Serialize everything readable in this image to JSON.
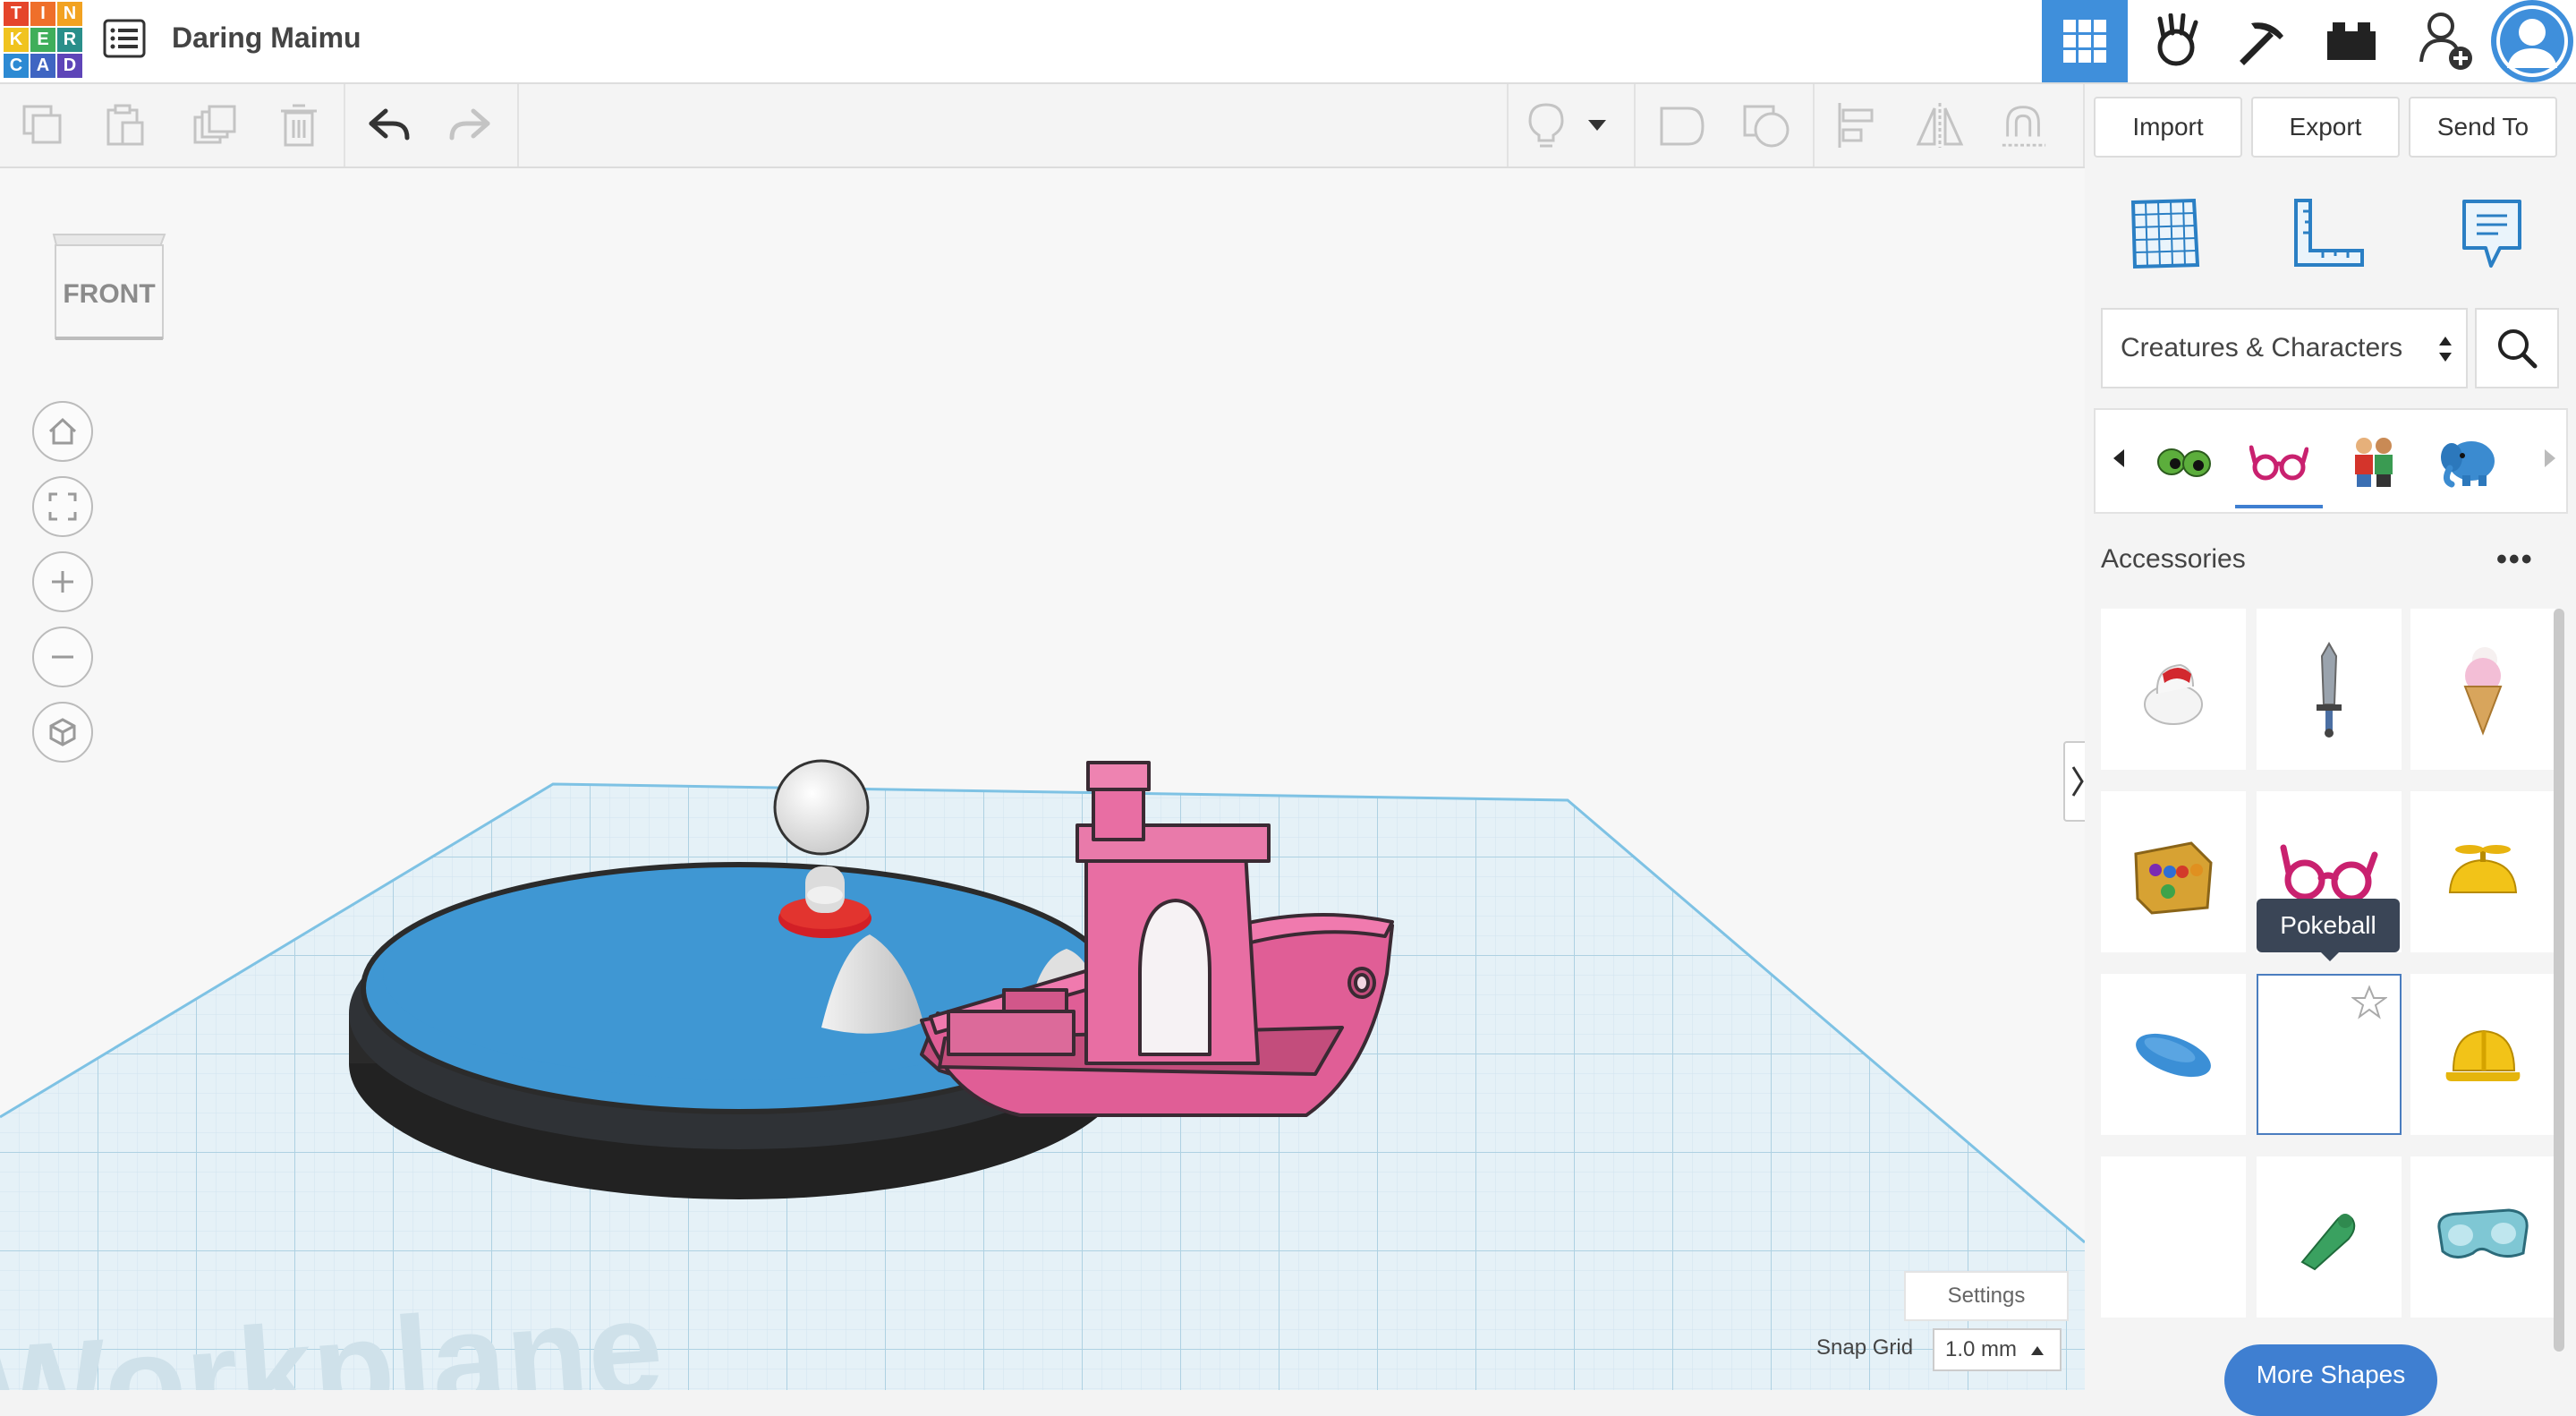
{
  "app": {
    "logo_letters": [
      "T",
      "I",
      "N",
      "K",
      "E",
      "R",
      "C",
      "A",
      "D"
    ],
    "logo_colors": [
      "#e5452b",
      "#ef6f2a",
      "#f2a221",
      "#f0c31f",
      "#3fae5a",
      "#2a8f8a",
      "#2d8ad3",
      "#3f65c2",
      "#5e45b8"
    ],
    "project_title": "Daring Maimu"
  },
  "header": {
    "icons": [
      "grid-view-icon",
      "tinker-hand-icon",
      "pickaxe-icon",
      "bricks-icon",
      "add-user-icon",
      "user-avatar"
    ],
    "active_icon": "grid-view-icon",
    "accent": "#3f8fdb"
  },
  "toolbar": {
    "icons": [
      "copy-icon",
      "paste-icon",
      "duplicate-icon",
      "delete-icon",
      "undo-icon",
      "redo-icon",
      "lightbulb-icon",
      "dropdown-icon",
      "group-icon",
      "ungroup-icon",
      "align-icon",
      "mirror-icon",
      "magnet-icon"
    ],
    "import_label": "Import",
    "export_label": "Export",
    "send_to_label": "Send To"
  },
  "viewport": {
    "view_cube_label": "FRONT",
    "nav_buttons": [
      "home-icon",
      "fit-view-icon",
      "zoom-in-icon",
      "zoom-out-icon",
      "perspective-icon"
    ],
    "settings_label": "Settings",
    "snap_grid_label": "Snap Grid",
    "snap_grid_value": "1.0 mm",
    "workplane_watermark": "Workplane"
  },
  "panel": {
    "top_icons": [
      "workplane-icon",
      "ruler-icon",
      "notes-icon"
    ],
    "category": "Creatures & Characters",
    "category_tabs": [
      "eyes-icon",
      "glasses-icon",
      "figures-icon",
      "elephant-icon"
    ],
    "active_tab": "glasses-icon",
    "section_title": "Accessories",
    "more_dots": "•••",
    "tooltip": "Pokeball",
    "more_shapes_label": "More Shapes",
    "shapes": [
      "hat-shape",
      "sword-shape",
      "ice-cream-shape",
      "gauntlet-shape",
      "glasses-shape",
      "propeller-hat-shape",
      "beret-shape",
      "pokeball-shape",
      "hard-hat-shape",
      "empty-shape",
      "flipper-shape",
      "goggles-shape"
    ]
  }
}
